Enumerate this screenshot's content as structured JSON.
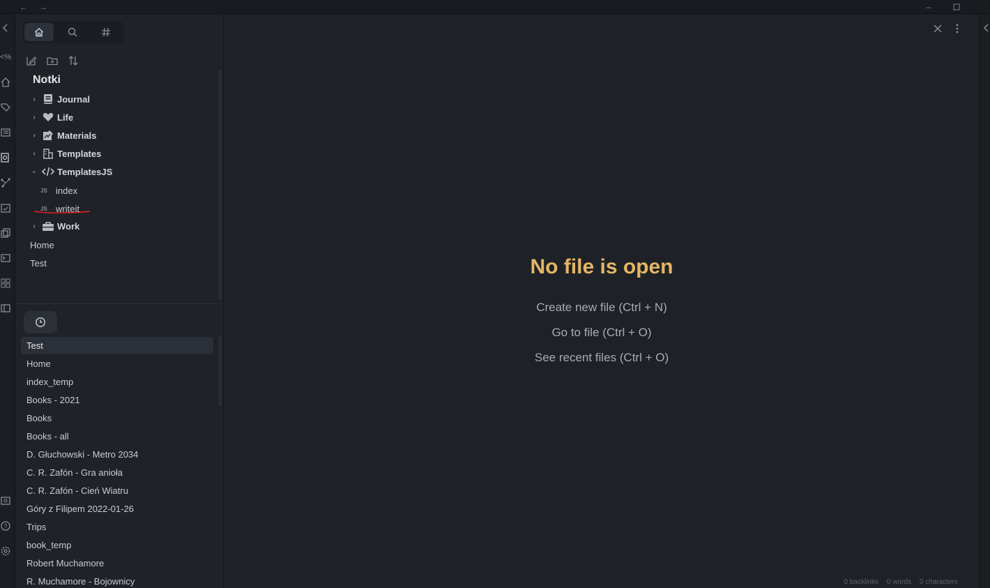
{
  "colors": {
    "accent_title": "#e5b565",
    "annotation": "#e02020",
    "background": "#1e2227"
  },
  "titlebar": {
    "back_icon": "arrow-left-icon",
    "forward_icon": "arrow-right-icon",
    "minimize_icon": "minimize-icon",
    "maximize_icon": "maximize-icon"
  },
  "ribbon": {
    "icons": [
      "templater-icon",
      "home-icon",
      "tag-pen-icon",
      "list-icon",
      "search-file-icon",
      "graph-icon",
      "calendar-icon",
      "copy-icon",
      "terminal-icon",
      "grid-icon",
      "layout-icon",
      "vault-icon",
      "help-icon",
      "settings-icon"
    ]
  },
  "sidebar": {
    "tabs": [
      {
        "name": "files",
        "icon": "home-icon"
      },
      {
        "name": "search",
        "icon": "search-icon"
      },
      {
        "name": "tags",
        "icon": "hash-icon"
      }
    ],
    "actions": [
      "new-note-icon",
      "new-folder-icon",
      "sort-icon"
    ],
    "vault_name": "Notki",
    "folders": [
      {
        "label": "Journal",
        "icon": "book-icon",
        "expanded": false
      },
      {
        "label": "Life",
        "icon": "heart-icon",
        "expanded": false
      },
      {
        "label": "Materials",
        "icon": "chart-icon",
        "expanded": false
      },
      {
        "label": "Templates",
        "icon": "building-icon",
        "expanded": false
      },
      {
        "label": "TemplatesJS",
        "icon": "code-icon",
        "expanded": true
      },
      {
        "label": "Work",
        "icon": "briefcase-icon",
        "expanded": false
      }
    ],
    "templatesjs_files": [
      {
        "ext": "JS",
        "label": "index"
      },
      {
        "ext": "JS",
        "label": "writeit"
      }
    ],
    "root_files": [
      "Home",
      "Test"
    ]
  },
  "recent": {
    "tab_icon": "clock-icon",
    "items": [
      "Test",
      "Home",
      "index_temp",
      "Books - 2021",
      "Books",
      "Books - all",
      "D. Głuchowski - Metro 2034",
      "C. R. Zafón - Gra anioła",
      "C. R. Zafón - Cień Wiatru",
      "Góry z Filipem 2022-01-26",
      "Trips",
      "book_temp",
      "Robert Muchamore",
      "R. Muchamore - Bojownicy"
    ],
    "active": "Test"
  },
  "main": {
    "close_icon": "close-icon",
    "more_icon": "more-vertical-icon",
    "empty_title": "No file is open",
    "actions": [
      "Create new file (Ctrl + N)",
      "Go to file (Ctrl + O)",
      "See recent files (Ctrl + O)"
    ]
  },
  "statusbar": {
    "backlinks": "0 backlinks",
    "words": "0 words",
    "characters": "0 characters"
  }
}
